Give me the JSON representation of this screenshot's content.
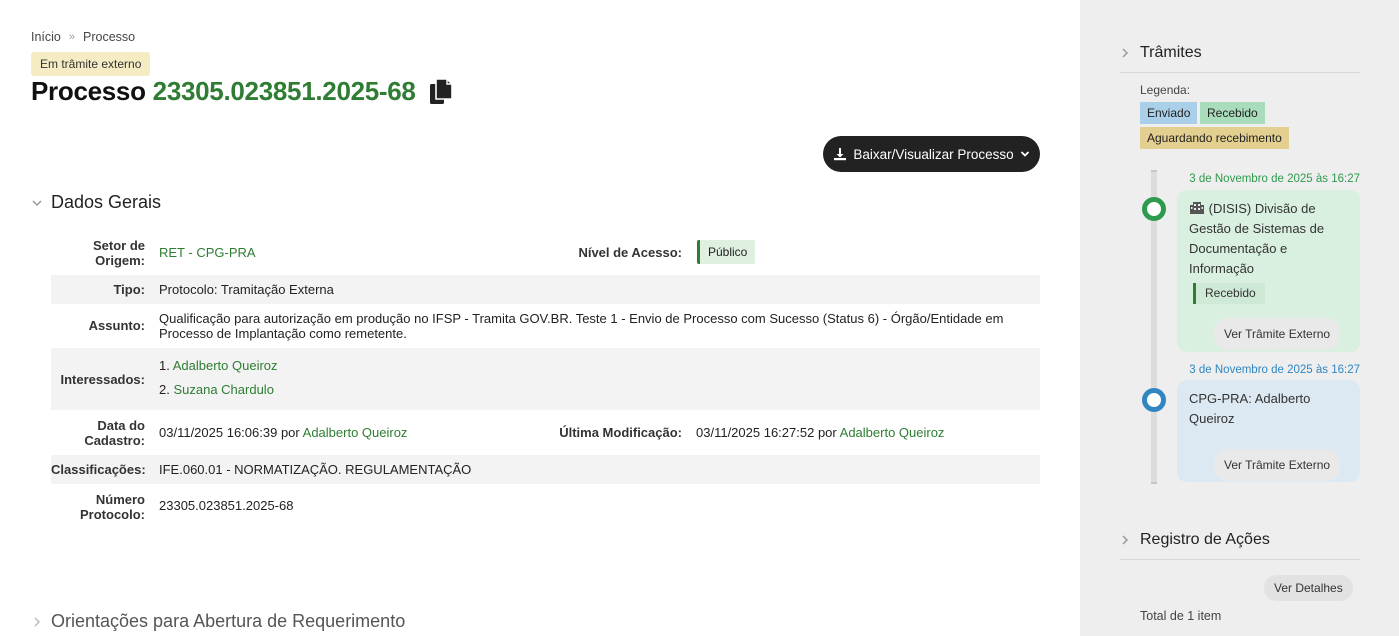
{
  "breadcrumb": {
    "home": "Início",
    "current": "Processo"
  },
  "status_badge": "Em trâmite externo",
  "title": {
    "prefix": "Processo",
    "number": "23305.023851.2025-68"
  },
  "download_button": "Baixar/Visualizar Processo",
  "sections": {
    "general": "Dados Gerais",
    "guidelines": "Orientações para Abertura de Requerimento"
  },
  "fields": {
    "setor_origem_label": "Setor de Origem:",
    "setor_origem": "RET - CPG-PRA",
    "nivel_acesso_label": "Nível de Acesso:",
    "nivel_acesso": "Público",
    "tipo_label": "Tipo:",
    "tipo": "Protocolo: Tramitação Externa",
    "assunto_label": "Assunto:",
    "assunto": "Qualificação para autorização em produção no IFSP - Tramita GOV.BR. Teste 1 - Envio de Processo com Sucesso (Status 6) - Órgão/Entidade em Processo de Implantação como remetente.",
    "interessados_label": "Interessados:",
    "interessados": [
      "Adalberto Queiroz",
      "Suzana Chardulo"
    ],
    "data_cadastro_label": "Data do Cadastro:",
    "data_cadastro": "03/11/2025 16:06:39",
    "por": "por",
    "data_cadastro_user": "Adalberto Queiroz",
    "ultima_mod_label": "Última Modificação:",
    "ultima_mod": "03/11/2025 16:27:52",
    "ultima_mod_user": "Adalberto Queiroz",
    "classificacoes_label": "Classificações:",
    "classificacoes": "IFE.060.01 - NORMATIZAÇÃO. REGULAMENTAÇÃO",
    "numero_protocolo_label": "Número Protocolo:",
    "numero_protocolo": "23305.023851.2025-68"
  },
  "sidebar": {
    "tramites_title": "Trâmites",
    "legend_label": "Legenda:",
    "legend": [
      {
        "label": "Enviado",
        "color": "#a9cfe9"
      },
      {
        "label": "Recebido",
        "color": "#a8dcbb"
      },
      {
        "label": "Aguardando recebimento",
        "color": "#e3cf8f"
      }
    ],
    "timeline": [
      {
        "date": "3 de Novembro de 2025 às 16:27",
        "date_color": "#2e9a4e",
        "text": "(DISIS) Divisão de Gestão de Sistemas de Documentação e Informação",
        "status": "Recebido",
        "button": "Ver Trâmite Externo",
        "card_color": "#d9efdf",
        "dot_color": "#2e9a4e"
      },
      {
        "date": "3 de Novembro de 2025 às 16:27",
        "date_color": "#2f86c1",
        "text": "CPG-PRA: Adalberto Queiroz",
        "button": "Ver Trâmite Externo",
        "card_color": "#dde9f2",
        "dot_color": "#2f86c1"
      }
    ],
    "registro_title": "Registro de Ações",
    "ver_detalhes": "Ver Detalhes",
    "total": "Total de 1 item"
  }
}
